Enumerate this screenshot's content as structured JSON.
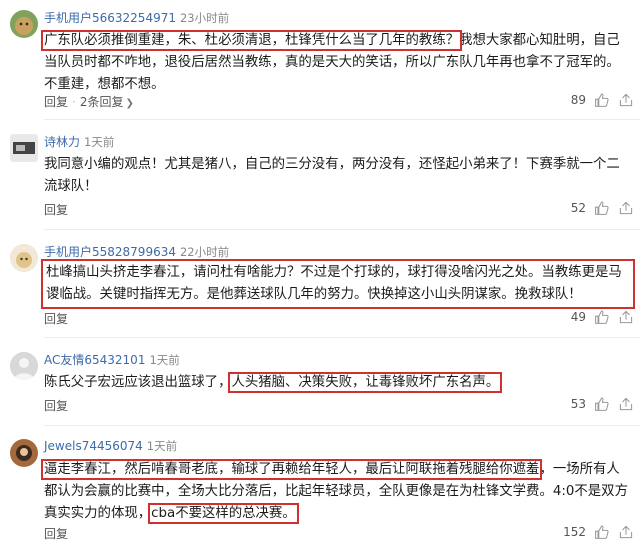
{
  "comments": [
    {
      "user": "手机用户56632254971",
      "time": "23小时前",
      "text_hl": "广东队必须推倒重建，朱、杜必须清退，杜锋凭什么当了几年的教练？",
      "text_rest": "我想大家都心知肚明，自己当队员时都不咋地，退役后居然当教练，真的是天大的笑话，所以广东队几年再也拿不了冠军的。不重建，想都不想。",
      "reply": "回复",
      "reply_count": "2条回复",
      "likes": "89"
    },
    {
      "user": "诗林力",
      "time": "1天前",
      "text": "我同意小编的观点！尤其是猪八，自己的三分没有，两分没有，还怪起小弟来了！下赛季就一个二流球队！",
      "reply": "回复",
      "likes": "52"
    },
    {
      "user": "手机用户55828799634",
      "time": "22小时前",
      "text_hl": "杜峰搞山头挤走李春江，请问杜有啥能力？不过是个打球的，球打得没啥闪光之处。当教练更是马谡临战。关键时指挥无方。是他葬送球队几年的努力。快换掉这小山头阴谋家。挽救球队！",
      "reply": "回复",
      "likes": "49"
    },
    {
      "user": "AC友情65432101",
      "time": "1天前",
      "text_pre": "陈氏父子宏远应该退出篮球了，",
      "text_hl": "人头猪脑、决策失败，让毒锋败坏广东名声。",
      "reply": "回复",
      "likes": "53"
    },
    {
      "user": "Jewels74456074",
      "time": "1天前",
      "text_hl1": "逼走李春江，然后啃春哥老底，输球了再赖给年轻人，最后让阿联拖着残腿给你遮羞",
      "text_mid": "，一场所有人都认为会赢的比赛中，全场大比分落后，比起年轻球员，全队更像是在为杜锋文学费。4:0不是双方真实实力的体现，",
      "text_hl2": "cba不要这样的总决赛。",
      "reply": "回复",
      "likes": "152"
    }
  ]
}
